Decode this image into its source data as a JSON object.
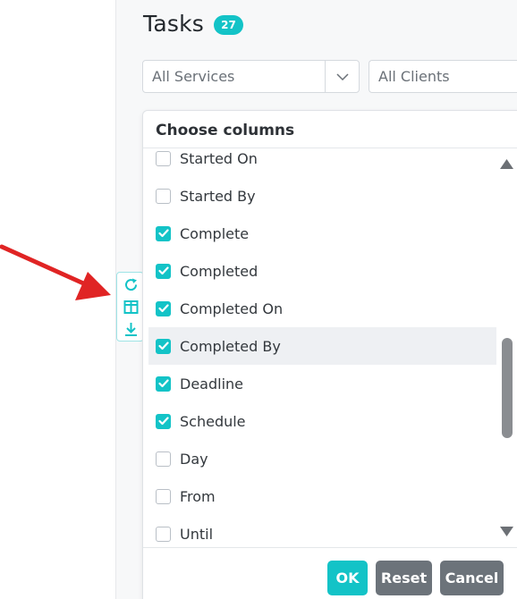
{
  "page": {
    "title": "Tasks",
    "count_badge": "27"
  },
  "filters": {
    "services": "All Services",
    "clients": "All Clients"
  },
  "toolbar": {
    "icons": [
      "refresh-icon",
      "columns-icon",
      "download-icon"
    ]
  },
  "column_chooser": {
    "title": "Choose columns",
    "options": [
      {
        "label": "Started On",
        "checked": false
      },
      {
        "label": "Started By",
        "checked": false
      },
      {
        "label": "Complete",
        "checked": true
      },
      {
        "label": "Completed",
        "checked": true
      },
      {
        "label": "Completed On",
        "checked": true
      },
      {
        "label": "Completed By",
        "checked": true,
        "highlighted": true
      },
      {
        "label": "Deadline",
        "checked": true
      },
      {
        "label": "Schedule",
        "checked": true
      },
      {
        "label": "Day",
        "checked": false
      },
      {
        "label": "From",
        "checked": false
      },
      {
        "label": "Until",
        "checked": false
      }
    ],
    "buttons": {
      "ok": "OK",
      "reset": "Reset",
      "cancel": "Cancel"
    }
  },
  "colors": {
    "accent": "#13c3c7",
    "secondary_button": "#6c737a",
    "annotation_arrow": "#e02424"
  }
}
